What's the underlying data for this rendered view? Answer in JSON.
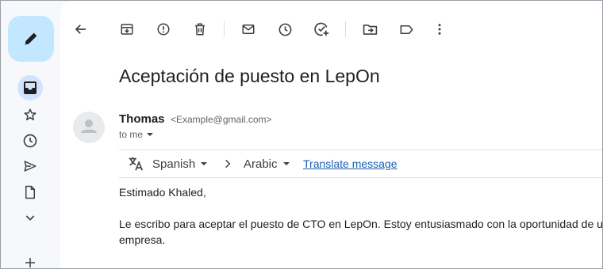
{
  "toolbar": {
    "icons": [
      "back-arrow-icon",
      "archive-icon",
      "report-spam-icon",
      "delete-icon",
      "mark-unread-icon",
      "snooze-icon",
      "add-to-tasks-icon",
      "move-to-icon",
      "label-icon",
      "more-icon"
    ]
  },
  "rail": {
    "icons": [
      "compose-pencil-icon",
      "inbox-icon",
      "starred-icon",
      "snoozed-icon",
      "sent-icon",
      "drafts-icon",
      "more-chevron-icon",
      "add-label-icon"
    ]
  },
  "message": {
    "subject": "Aceptación de puesto en LepOn",
    "sender_name": "Thomas",
    "sender_email": "<Example@gmail.com>",
    "to_label": "to me",
    "body_line_1": "Estimado Khaled,",
    "body_line_2": "Le escribo para aceptar el puesto de CTO en LepOn. Estoy entusiasmado con la oportunidad de unirm",
    "body_line_3": "empresa."
  },
  "translate": {
    "source_lang": "Spanish",
    "target_lang": "Arabic",
    "translate_link": "Translate message"
  },
  "colors": {
    "compose_bg": "#c2e7ff",
    "active_rail_bg": "#d3e3fd",
    "link": "#1a5fb4",
    "app_bg": "#f6f8fc"
  }
}
